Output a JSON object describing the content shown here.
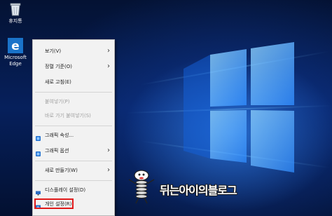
{
  "desktop": {
    "icons": [
      {
        "label": "휴지통",
        "icon": "recycle-bin-icon"
      },
      {
        "label": "Microsoft Edge",
        "icon": "edge-icon"
      }
    ],
    "watermark": "뒤는아이의블로그"
  },
  "context_menu": {
    "items": [
      {
        "label": "보기(V)",
        "submenu": true,
        "enabled": true
      },
      {
        "label": "정렬 기준(O)",
        "submenu": true,
        "enabled": true
      },
      {
        "label": "새로 고침(E)",
        "submenu": false,
        "enabled": true
      },
      {
        "label": "붙여넣기(P)",
        "submenu": false,
        "enabled": false
      },
      {
        "label": "바로 가기 붙여넣기(S)",
        "submenu": false,
        "enabled": false
      },
      {
        "label": "그래픽 속성...",
        "submenu": false,
        "enabled": true,
        "icon": "graphics-properties-icon"
      },
      {
        "label": "그래픽 옵션",
        "submenu": true,
        "enabled": true,
        "icon": "graphics-options-icon"
      },
      {
        "label": "새로 만들기(W)",
        "submenu": true,
        "enabled": true
      },
      {
        "label": "디스플레이 설정(D)",
        "submenu": false,
        "enabled": true,
        "icon": "display-settings-icon"
      },
      {
        "label": "개인 설정(R)",
        "submenu": false,
        "enabled": true,
        "icon": "personalize-icon",
        "highlighted": true
      }
    ],
    "submenu_arrow": "›"
  },
  "colors": {
    "menu_bg": "#f2f2f2",
    "highlight_border": "#e01919",
    "desktop_bg": "#06205c"
  }
}
